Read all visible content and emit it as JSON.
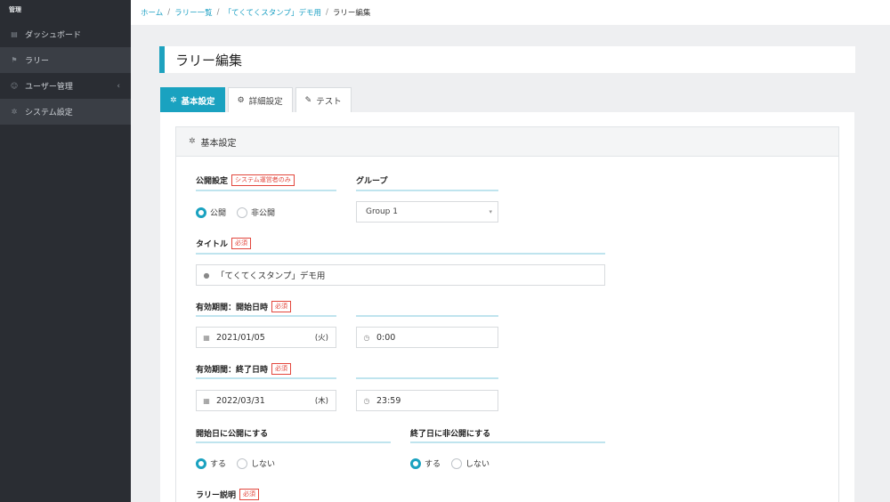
{
  "sidebar": {
    "header": "管理",
    "items": [
      {
        "label": "ダッシュボード",
        "icon": "dashboard-icon"
      },
      {
        "label": "ラリー",
        "icon": "rally-icon"
      },
      {
        "label": "ユーザー管理",
        "icon": "users-icon"
      },
      {
        "label": "システム設定",
        "icon": "gear-icon"
      }
    ]
  },
  "breadcrumb": {
    "home": "ホーム",
    "rally_list": "ラリー一覧",
    "rally_name": "「てくてくスタンプ」デモ用",
    "current": "ラリー編集",
    "sep": "/"
  },
  "page": {
    "title": "ラリー編集"
  },
  "tabs": [
    {
      "label": "基本設定"
    },
    {
      "label": "詳細設定"
    },
    {
      "label": "テスト"
    }
  ],
  "card": {
    "title": "基本設定"
  },
  "form": {
    "publish": {
      "label": "公開設定",
      "badge": "システム運営者のみ",
      "options": [
        "公開",
        "非公開"
      ],
      "selected": "公開"
    },
    "group": {
      "label": "グループ",
      "value": "Group 1"
    },
    "title": {
      "label": "タイトル",
      "badge": "必須",
      "value": "「てくてくスタンプ」デモ用"
    },
    "start": {
      "label": "有効期間：開始日時",
      "badge": "必須",
      "date": "2021/01/05",
      "dow": "(火)",
      "time": "0:00"
    },
    "end": {
      "label": "有効期間：終了日時",
      "badge": "必須",
      "date": "2022/03/31",
      "dow": "(木)",
      "time": "23:59"
    },
    "publish_on_start": {
      "label": "開始日に公開にする",
      "options": [
        "する",
        "しない"
      ],
      "selected": "する"
    },
    "unpublish_on_end": {
      "label": "終了日に非公開にする",
      "options": [
        "する",
        "しない"
      ],
      "selected": "する"
    },
    "description": {
      "label": "ラリー説明",
      "badge": "必須"
    }
  },
  "colors": {
    "accent": "#1aa2c0",
    "sidebar_bg": "#2a2d33",
    "required_badge": "#e2463c"
  }
}
